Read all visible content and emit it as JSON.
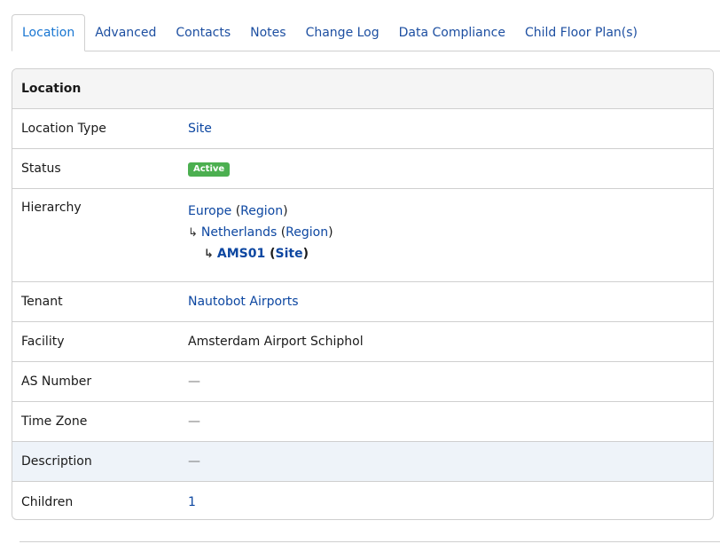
{
  "tabs": [
    {
      "label": "Location",
      "active": true
    },
    {
      "label": "Advanced"
    },
    {
      "label": "Contacts"
    },
    {
      "label": "Notes"
    },
    {
      "label": "Change Log"
    },
    {
      "label": "Data Compliance"
    },
    {
      "label": "Child Floor Plan(s)"
    }
  ],
  "panel": {
    "title": "Location",
    "rows": {
      "location_type": {
        "label": "Location Type",
        "value": "Site"
      },
      "status": {
        "label": "Status",
        "value": "Active",
        "color": "#4caf50"
      },
      "hierarchy": {
        "label": "Hierarchy",
        "items": [
          {
            "name": "Europe",
            "type": "Region"
          },
          {
            "name": "Netherlands",
            "type": "Region"
          },
          {
            "name": "AMS01",
            "type": "Site"
          }
        ]
      },
      "tenant": {
        "label": "Tenant",
        "value": "Nautobot Airports"
      },
      "facility": {
        "label": "Facility",
        "value": "Amsterdam Airport Schiphol"
      },
      "as_number": {
        "label": "AS Number",
        "value": "—"
      },
      "time_zone": {
        "label": "Time Zone",
        "value": "—"
      },
      "description": {
        "label": "Description",
        "value": "—"
      },
      "children": {
        "label": "Children",
        "value": "1"
      }
    }
  },
  "symbols": {
    "arrow": "↳",
    "open_paren": "(",
    "close_paren": ")"
  }
}
